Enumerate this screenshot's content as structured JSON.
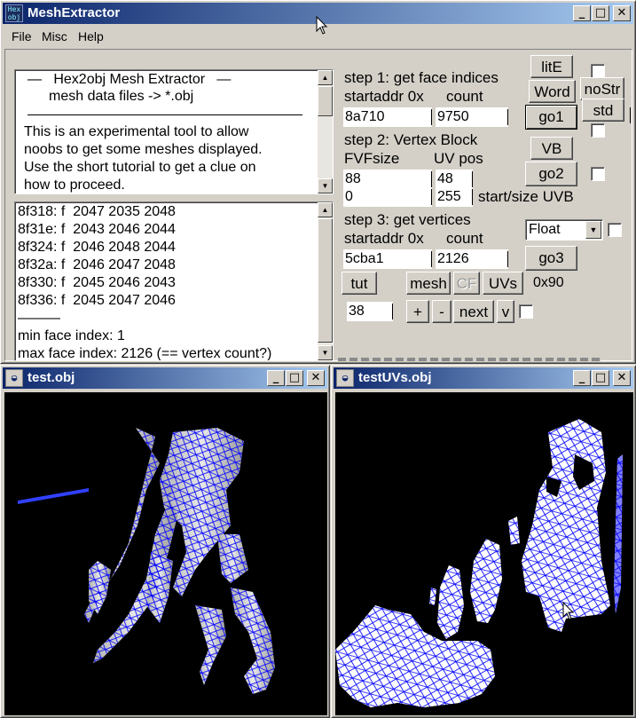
{
  "main_window": {
    "title": "MeshExtractor",
    "icon_text": [
      "Hex",
      "obj"
    ],
    "menu": [
      "File",
      "Misc",
      "Help"
    ],
    "info_text": {
      "lines": [
        "—   Hex2obj Mesh Extractor   —",
        "mesh data files -> *.obj",
        "This is an experimental tool to allow",
        "noobs to get some meshes displayed.",
        "Use the short tutorial to get a clue on",
        "how to proceed."
      ]
    },
    "face_list": {
      "lines": [
        "8f318: f  2047 2035 2048",
        "8f31e: f  2043 2046 2044",
        "8f324: f  2046 2048 2044",
        "8f32a: f  2046 2047 2048",
        "8f330: f  2045 2046 2043",
        "8f336: f  2045 2047 2046",
        "———",
        "min face index: 1",
        "max face index: 2126 (== vertex count?)"
      ]
    },
    "step1": {
      "title": "step 1: get face indices",
      "label_addr": "startaddr 0x",
      "label_count": "count",
      "addr_value": "8a710",
      "count_value": "9750"
    },
    "step2": {
      "title": "step 2: Vertex Block",
      "label_fvf": "FVFsize",
      "label_uv": "UV pos",
      "fvf_value": "88",
      "uv_value": "48",
      "start_value": "0",
      "size_value": "255",
      "uvb_label": "start/size UVB"
    },
    "step3": {
      "title": "step 3: get vertices",
      "label_addr": "startaddr 0x",
      "label_count": "count",
      "addr_value": "5cba1",
      "count_value": "2126",
      "format_selected": "Float"
    },
    "buttons": {
      "lite": "litE",
      "word": "Word",
      "nostr": "noStr",
      "go1": "go1",
      "std": "std",
      "vb": "VB",
      "go2": "go2",
      "go3": "go3",
      "tut": "tut",
      "mesh": "mesh",
      "cf": "CF",
      "uvs": "UVs",
      "hex_label": "0x90",
      "plus": "+",
      "minus": "-",
      "next": "next",
      "v": "v"
    },
    "next_field_value": "38"
  },
  "mesh_window": {
    "title": "test.obj"
  },
  "uv_window": {
    "title": "testUVs.obj"
  },
  "colors": {
    "title_start": "#0a246a",
    "title_end": "#a6caf0",
    "wire": "#0000ff",
    "viewport": "#000000"
  },
  "icons": [
    "minimize-icon",
    "maximize-icon",
    "close-icon",
    "scroll-up-icon",
    "scroll-down-icon",
    "dropdown-arrow-icon",
    "mouse-pointer-icon"
  ]
}
